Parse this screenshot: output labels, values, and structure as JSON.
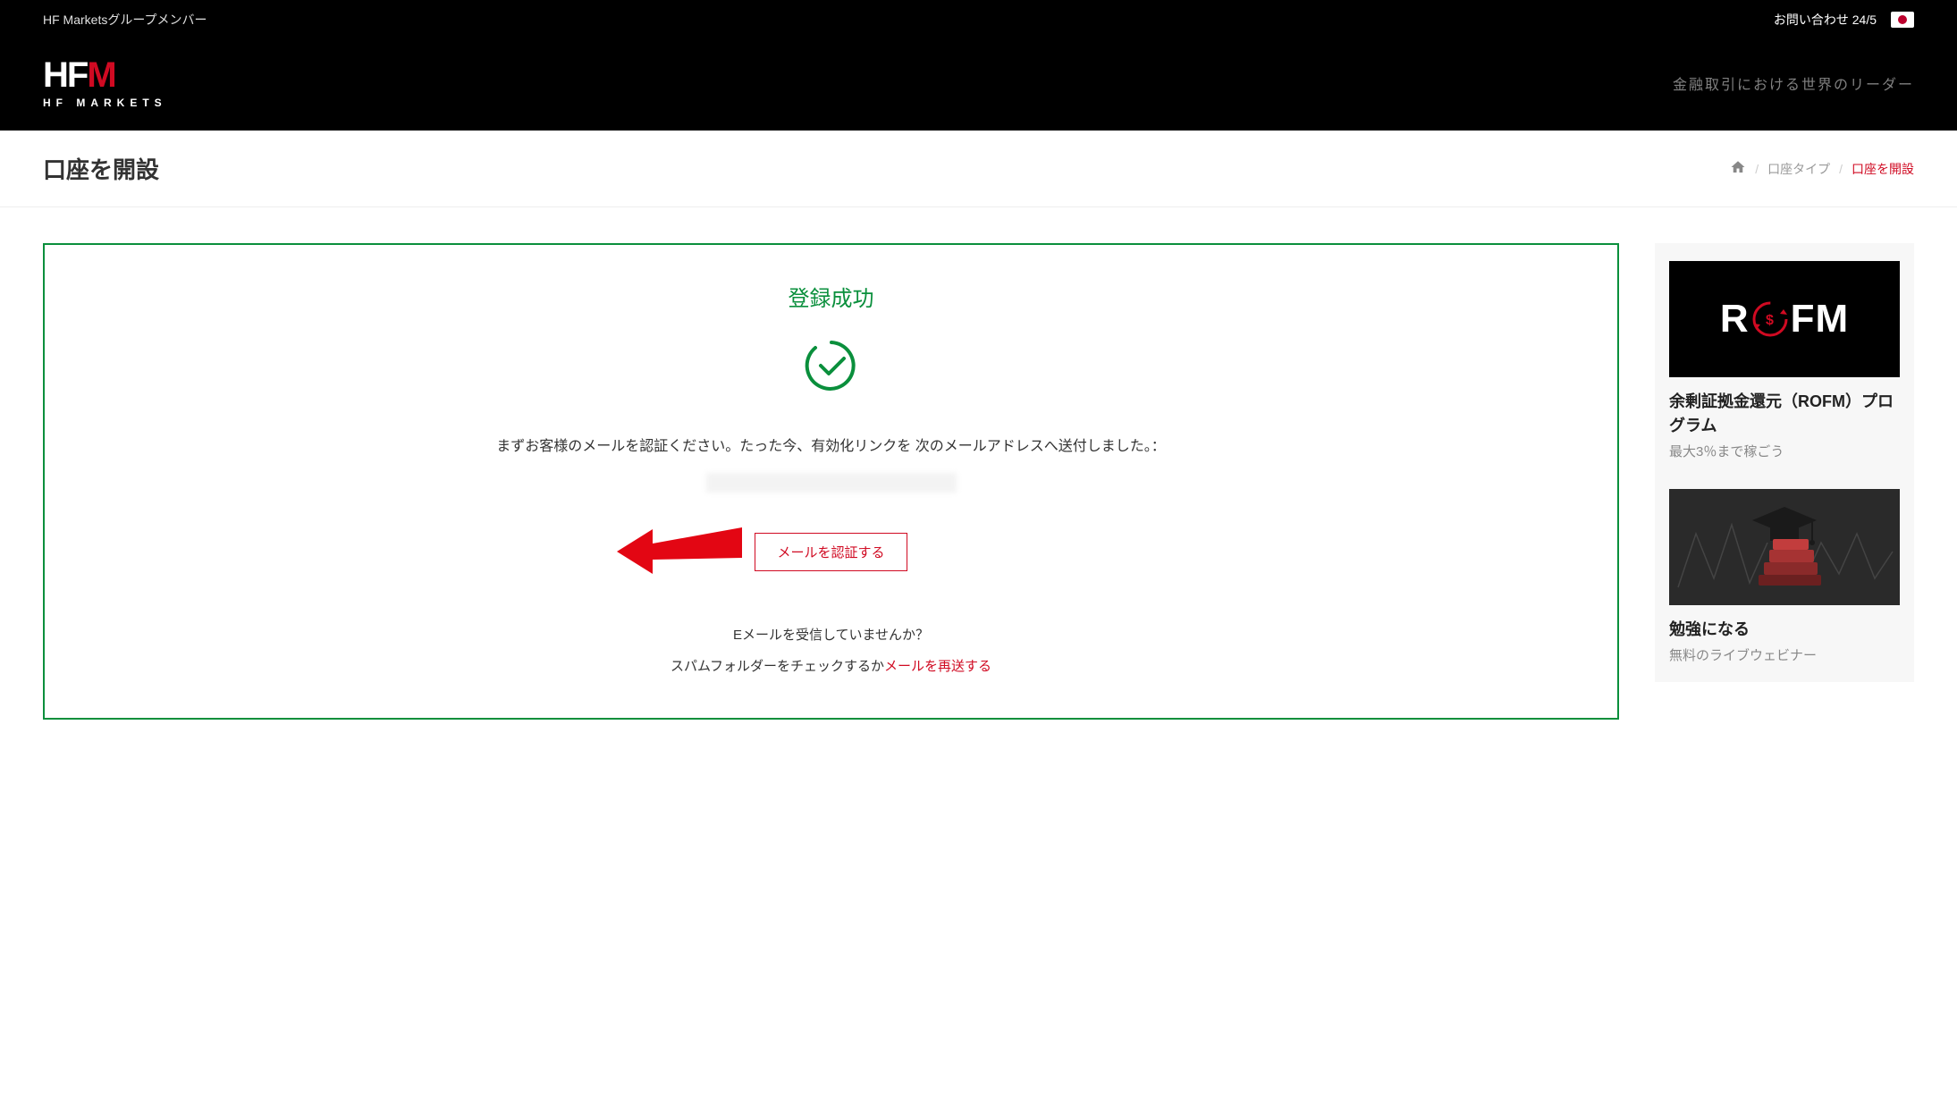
{
  "topbar": {
    "group_member": "HF Marketsグループメンバー",
    "contact": "お問い合わせ 24/5"
  },
  "header": {
    "logo_text": "HFM",
    "logo_sub": "HF MARKETS",
    "tagline": "金融取引における世界のリーダー"
  },
  "title_row": {
    "page_title": "口座を開設",
    "crumb1": "口座タイプ",
    "crumb2": "口座を開設"
  },
  "main": {
    "success_title": "登録成功",
    "msg1": "まずお客様のメールを認証ください。たった今、有効化リンクを 次のメールアドレスへ送付しました。：",
    "verify_btn": "メールを認証する",
    "q1": "Eメールを受信していませんか？",
    "q2_pre": "スパムフォルダーをチェックするか",
    "q2_link": "メールを再送する"
  },
  "sidebar": {
    "promo1": {
      "title": "余剰証拠金還元（ROFM）プログラム",
      "sub": "最大3％まで稼ごう"
    },
    "promo2": {
      "title": "勉強になる",
      "sub": "無料のライブウェビナー"
    }
  }
}
